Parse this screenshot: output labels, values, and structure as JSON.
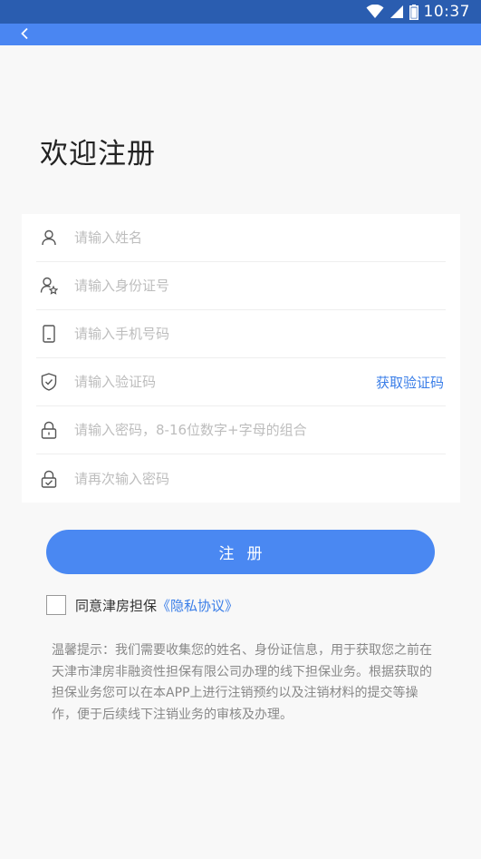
{
  "status_bar": {
    "time": "10:37",
    "icons": [
      "wifi-icon",
      "signal-icon",
      "battery-icon"
    ]
  },
  "nav": {
    "back_icon": "chevron-left-icon"
  },
  "page": {
    "title": "欢迎注册"
  },
  "form": {
    "name_placeholder": "请输入姓名",
    "id_placeholder": "请输入身份证号",
    "phone_placeholder": "请输入手机号码",
    "code_placeholder": "请输入验证码",
    "get_code_label": "获取验证码",
    "password_placeholder": "请输入密码，8-16位数字+字母的组合",
    "confirm_placeholder": "请再次输入密码"
  },
  "submit": {
    "label": "注册"
  },
  "agreement": {
    "text": "同意津房担保",
    "link": "《隐私协议》"
  },
  "notice": {
    "text": "温馨提示：我们需要收集您的姓名、身份证信息，用于获取您之前在天津市津房非融资性担保有限公司办理的线下担保业务。根据获取的担保业务您可以在本APP上进行注销预约以及注销材料的提交等操作，便于后续线下注销业务的审核及办理。"
  },
  "colors": {
    "status_bar": "#2a5db0",
    "primary": "#4a88f2",
    "link": "#3a7ee8",
    "background": "#f8f8f8"
  }
}
